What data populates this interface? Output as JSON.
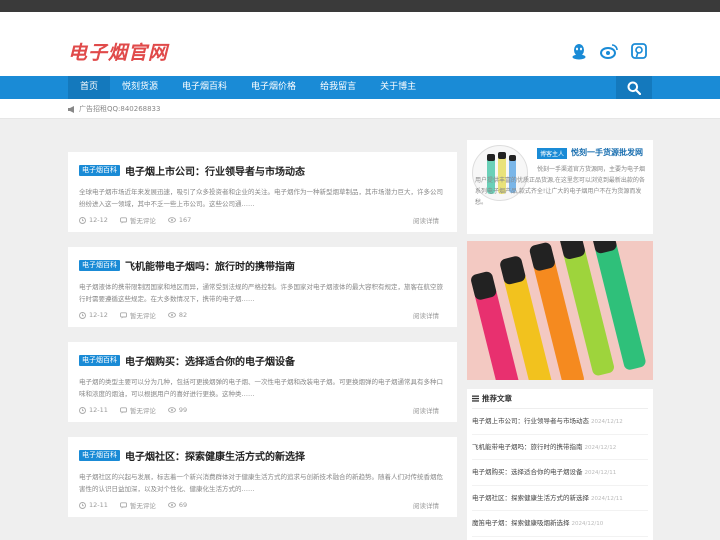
{
  "header": {
    "logo": "电子烟官网"
  },
  "nav": {
    "items": [
      {
        "label": "首页"
      },
      {
        "label": "悦刻货源"
      },
      {
        "label": "电子烟百科"
      },
      {
        "label": "电子烟价格"
      },
      {
        "label": "给我留言"
      },
      {
        "label": "关于博主"
      }
    ]
  },
  "adbar": {
    "text": "广告招租QQ:840268833"
  },
  "posts": [
    {
      "tag": "电子烟百科",
      "title": "电子烟上市公司：行业领导者与市场动态",
      "excerpt": "全球电子烟市场近年来发展迅速，吸引了众多投资者和企业的关注。电子烟作为一种新型烟草制品，其市场潜力巨大，许多公司纷纷进入这一领域，其中不乏一些上市公司。这些公司通……",
      "date": "12-12",
      "comments": "暂无评论",
      "views": "167",
      "read": "阅读详情"
    },
    {
      "tag": "电子烟百科",
      "title": "飞机能带电子烟吗：旅行时的携带指南",
      "excerpt": "电子烟液体的携带限制因国家和地区而异，通常受到法规的严格控制。许多国家对电子烟液体的最大容积有规定，旅客在航空旅行时需要遵循这些规定。在大多数情况下，携带的电子烟……",
      "date": "12-12",
      "comments": "暂无评论",
      "views": "82",
      "read": "阅读详情"
    },
    {
      "tag": "电子烟百科",
      "title": "电子烟购买：选择适合你的电子烟设备",
      "excerpt": "电子烟的类型主要可以分为几种，包括可更换烟弹的电子烟、一次性电子烟和改装电子烟。可更换烟弹的电子烟通常具有多种口味和浓度的烟油，可以根据用户的喜好进行更换。这种类……",
      "date": "12-11",
      "comments": "暂无评论",
      "views": "99",
      "read": "阅读详情"
    },
    {
      "tag": "电子烟百科",
      "title": "电子烟社区：探索健康生活方式的新选择",
      "excerpt": "电子烟社区的兴起与发展，标志着一个新兴消费群体对于健康生活方式的追求与创新技术融合的新趋势。随着人们对传统香烟危害性的认识日益加深，以及对个性化、健康化生活方式的……",
      "date": "12-11",
      "comments": "暂无评论",
      "views": "69",
      "read": "阅读详情"
    }
  ],
  "author": {
    "role": "博客主人",
    "name": "悦刻一手货源批发网",
    "desc": "悦刻一手渠道官方货源网，主要为电子烟用户提供丰富的优质正品货源,在这里您可以浏览到最新出款的各系列电子烟产品,款式齐全!让广大的电子烟用户不在为货源而发愁。"
  },
  "recommend": {
    "heading": "推荐文章",
    "items": [
      {
        "title": "电子烟上市公司：行业领导者与市场动态",
        "date": "2024/12/12"
      },
      {
        "title": "飞机能带电子烟吗：旅行时的携带指南",
        "date": "2024/12/12"
      },
      {
        "title": "电子烟购买：选择适合你的电子烟设备",
        "date": "2024/12/11"
      },
      {
        "title": "电子烟社区：探索健康生活方式的新选择",
        "date": "2024/12/11"
      },
      {
        "title": "魔笛电子烟：探索健康吸烟新选择",
        "date": "2024/12/10"
      }
    ]
  },
  "colors": {
    "brand": "#1a8bd6",
    "logo": "#e04a4a",
    "topbar": "#3a3a3a"
  }
}
